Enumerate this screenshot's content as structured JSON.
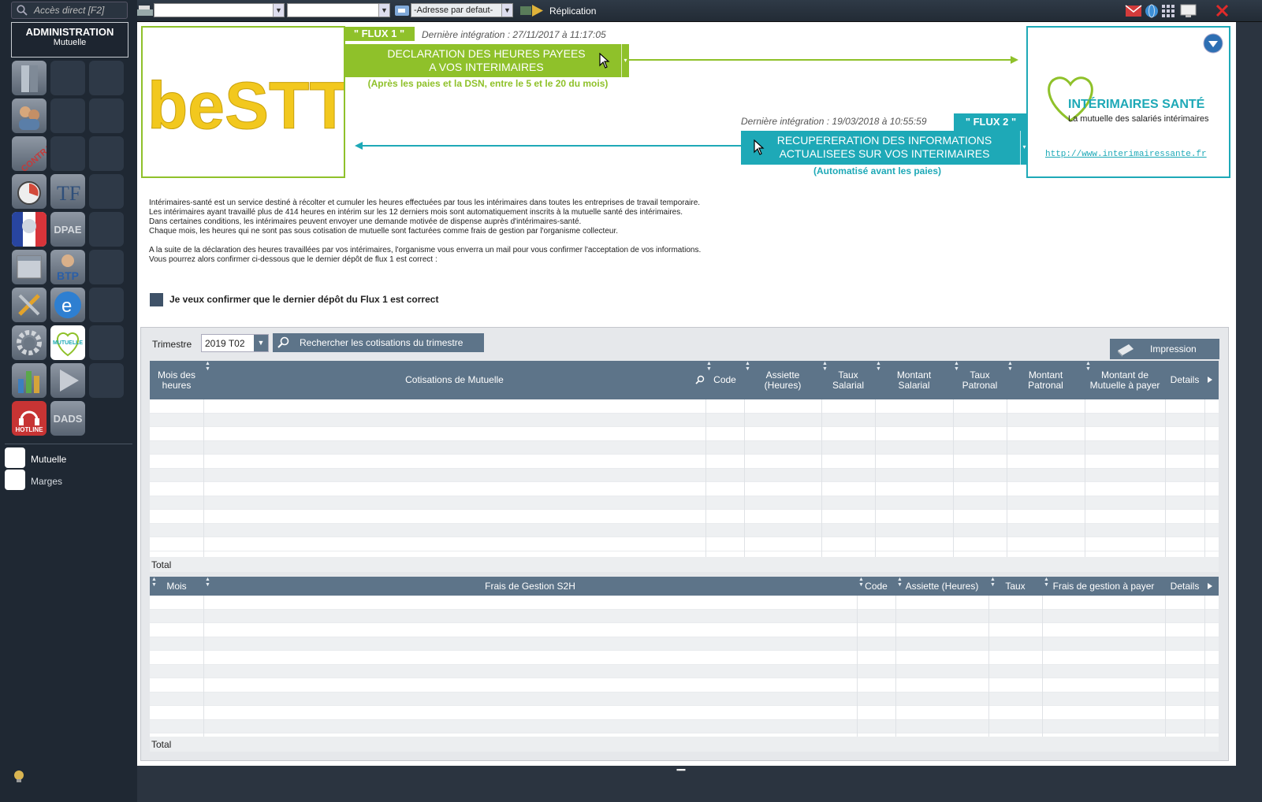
{
  "topbar": {
    "address_placeholder": "-Adresse par defaut-",
    "replication_label": "Réplication"
  },
  "sidebar": {
    "search_placeholder": "Accès direct [F2]",
    "admin_title": "ADMINISTRATION",
    "admin_subtitle": "Mutuelle",
    "tiles": {
      "dpae": "DPAE",
      "btp": "BTP",
      "hotline": "HOTLINE",
      "dads": "DADS",
      "mutuelle": "MUTUELLE",
      "contrat": "CONTRAT"
    },
    "items": [
      {
        "label": "Mutuelle"
      },
      {
        "label": "Marges"
      }
    ]
  },
  "flux1": {
    "tag": "\" FLUX 1 \"",
    "last_integration": "Dernière intégration :  27/11/2017 à 11:17:05",
    "button_line1": "DECLARATION DES HEURES PAYEES",
    "button_line2": "A VOS INTERIMAIRES",
    "subtitle": "(Après les paies et la DSN, entre le 5 et le 20 du mois)"
  },
  "flux2": {
    "tag": "\" FLUX 2 \"",
    "last_integration": "Dernière intégration :  19/03/2018 à 10:55:59",
    "button_line1": "RECUPERERATION DES INFORMATIONS",
    "button_line2": "ACTUALISEES SUR VOS INTERIMAIRES",
    "subtitle": "(Automatisé avant les paies)"
  },
  "brand": {
    "best_logo": "beSTT",
    "is_title": "INTÉRIMAIRES SANTÉ",
    "is_subtitle": "La mutuelle des salariés intérimaires",
    "is_link": "http://www.interimairessante.fr"
  },
  "description": {
    "lines1": [
      "Intérimaires-santé est un service destiné à récolter et cumuler les heures effectuées par tous les intérimaires dans toutes les entreprises de travail temporaire.",
      "Les intérimaires ayant travaillé plus de 414 heures en intérim sur les 12 derniers mois sont automatiquement inscrits à la mutuelle santé des intérimaires.",
      "Dans certaines conditions, les intérimaires peuvent envoyer une demande motivée de dispense auprès d'intérimaires-santé.",
      "Chaque mois, les heures qui ne sont pas sous cotisation de mutuelle sont facturées comme frais de gestion par l'organisme collecteur."
    ],
    "lines2": [
      "A la suite de la déclaration des heures travaillées par vos intérimaires, l'organisme vous enverra un mail pour vous confirmer l'acceptation de vos informations.",
      "Vous pourrez alors confirmer ci-dessous que le dernier dépôt de flux 1 est correct :"
    ]
  },
  "confirm_label": "Je veux confirmer que le dernier dépôt du Flux 1 est correct",
  "filters": {
    "trimestre_label": "Trimestre",
    "trimestre_value": "2019 T02",
    "search_button": "Rechercher les cotisations du trimestre",
    "print_button": "Impression"
  },
  "table1": {
    "headers": [
      {
        "line1": "Mois des",
        "line2": "heures"
      },
      {
        "line1": "Cotisations de Mutuelle",
        "line2": ""
      },
      {
        "line1": "Code",
        "line2": ""
      },
      {
        "line1": "Assiette",
        "line2": "(Heures)"
      },
      {
        "line1": "Taux",
        "line2": "Salarial"
      },
      {
        "line1": "Montant",
        "line2": "Salarial"
      },
      {
        "line1": "Taux",
        "line2": "Patronal"
      },
      {
        "line1": "Montant",
        "line2": "Patronal"
      },
      {
        "line1": "Montant de",
        "line2": "Mutuelle à payer"
      },
      {
        "line1": "Details",
        "line2": ""
      }
    ],
    "total_label": "Total"
  },
  "table2": {
    "headers": [
      "Mois",
      "Frais de Gestion S2H",
      "Code",
      "Assiette (Heures)",
      "Taux",
      "Frais de gestion à payer",
      "Details"
    ],
    "total_label": "Total"
  },
  "colors": {
    "flux1_green": "#8fc12a",
    "flux2_teal": "#1ea9b7",
    "header_slate": "#5d7489",
    "sidebar_bg": "#1f2833"
  }
}
